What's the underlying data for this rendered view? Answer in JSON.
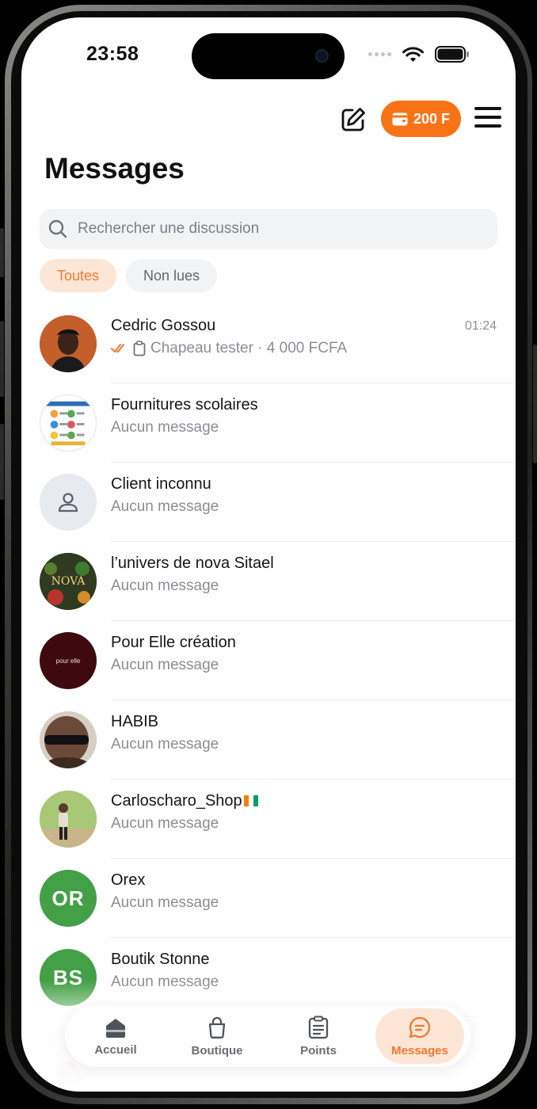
{
  "status_bar": {
    "time": "23:58"
  },
  "header": {
    "wallet_balance": "200 F",
    "title": "Messages"
  },
  "search": {
    "placeholder": "Rechercher une discussion"
  },
  "filters": {
    "all": "Toutes",
    "unread": "Non lues"
  },
  "conversations": [
    {
      "name": "Cedric Gossou",
      "time": "01:24",
      "last_message": "Chapeau tester · 4 000 FCFA"
    },
    {
      "name": "Fournitures scolaires",
      "last_message": "Aucun message"
    },
    {
      "name": "Client inconnu",
      "last_message": "Aucun message"
    },
    {
      "name": "l’univers de nova Sitael",
      "last_message": "Aucun message"
    },
    {
      "name": "Pour Elle création",
      "last_message": "Aucun message"
    },
    {
      "name": "HABIB",
      "last_message": "Aucun message"
    },
    {
      "name": "Carloscharo_Shop",
      "last_message": "Aucun message"
    },
    {
      "name": "Orex",
      "initials": "OR",
      "last_message": "Aucun message"
    },
    {
      "name": "Boutik Stonne",
      "initials": "BS",
      "last_message": "Aucun message"
    }
  ],
  "avatar_texts": {
    "nova": "NOVA",
    "pour_elle": "pour elle"
  },
  "nav": {
    "home": "Accueil",
    "shop": "Boutique",
    "points": "Points",
    "messages": "Messages"
  },
  "colors": {
    "accent": "#f97316",
    "accent_soft": "#fde6d6",
    "avatar_green": "#43a047"
  }
}
